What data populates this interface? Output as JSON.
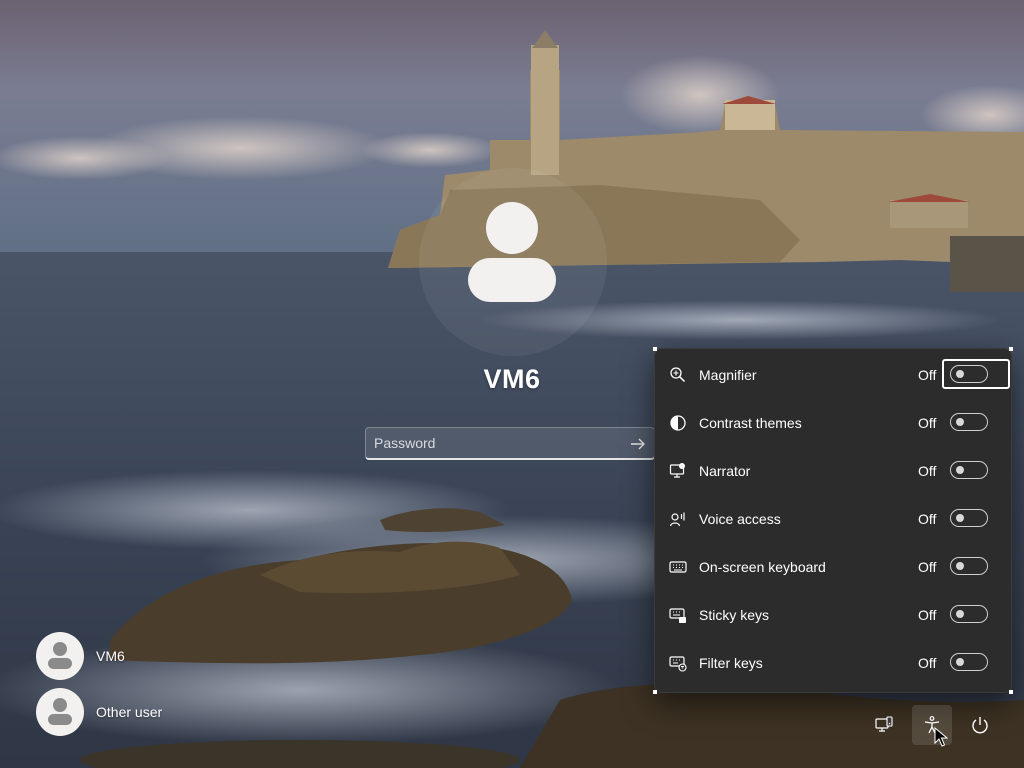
{
  "login": {
    "username": "VM6",
    "password_placeholder": "Password"
  },
  "accessibility_panel": {
    "items": [
      {
        "label": "Magnifier",
        "state": "Off",
        "icon": "magnifier-icon"
      },
      {
        "label": "Contrast themes",
        "state": "Off",
        "icon": "contrast-icon"
      },
      {
        "label": "Narrator",
        "state": "Off",
        "icon": "narrator-icon"
      },
      {
        "label": "Voice access",
        "state": "Off",
        "icon": "voice-access-icon"
      },
      {
        "label": "On-screen keyboard",
        "state": "Off",
        "icon": "keyboard-icon"
      },
      {
        "label": "Sticky keys",
        "state": "Off",
        "icon": "sticky-keys-icon"
      },
      {
        "label": "Filter keys",
        "state": "Off",
        "icon": "filter-keys-icon"
      }
    ]
  },
  "users": [
    {
      "name": "VM6"
    },
    {
      "name": "Other user"
    }
  ],
  "system_icons": [
    "network-icon",
    "accessibility-icon",
    "power-icon"
  ],
  "colors": {
    "panel_bg": "#2c2c2c",
    "toggle_off": "#cfcfcf"
  }
}
